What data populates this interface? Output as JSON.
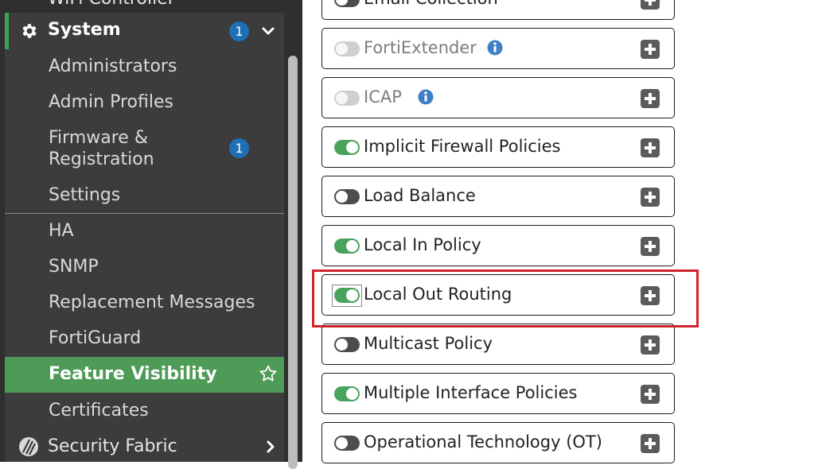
{
  "sidebar": {
    "cutoff_item": "WiFi Controller",
    "system": {
      "title": "System",
      "badge": "1"
    },
    "items": [
      {
        "label": "Administrators"
      },
      {
        "label": "Admin Profiles"
      },
      {
        "label_line1": "Firmware &",
        "label_line2": "Registration",
        "badge": "1"
      },
      {
        "label": "Settings"
      },
      {
        "label": "HA"
      },
      {
        "label": "SNMP"
      },
      {
        "label": "Replacement Messages"
      },
      {
        "label": "FortiGuard"
      },
      {
        "label": "Feature Visibility",
        "active": true
      },
      {
        "label": "Certificates"
      }
    ],
    "security_fabric": {
      "title": "Security Fabric"
    }
  },
  "features": [
    {
      "label": "Email Collection",
      "state": "off"
    },
    {
      "label": "FortiExtender",
      "state": "disabled",
      "info": true
    },
    {
      "label": "ICAP",
      "state": "disabled",
      "info": true
    },
    {
      "label": "Implicit Firewall Policies",
      "state": "on"
    },
    {
      "label": "Load Balance",
      "state": "off"
    },
    {
      "label": "Local In Policy",
      "state": "on"
    },
    {
      "label": "Local Out Routing",
      "state": "on",
      "highlighted": true
    },
    {
      "label": "Multicast Policy",
      "state": "off"
    },
    {
      "label": "Multiple Interface Policies",
      "state": "on"
    },
    {
      "label": "Operational Technology (OT)",
      "state": "off"
    }
  ],
  "colors": {
    "accent_green": "#4e9a57",
    "badge_blue": "#1e6fb5",
    "highlight_red": "#d0232c"
  }
}
